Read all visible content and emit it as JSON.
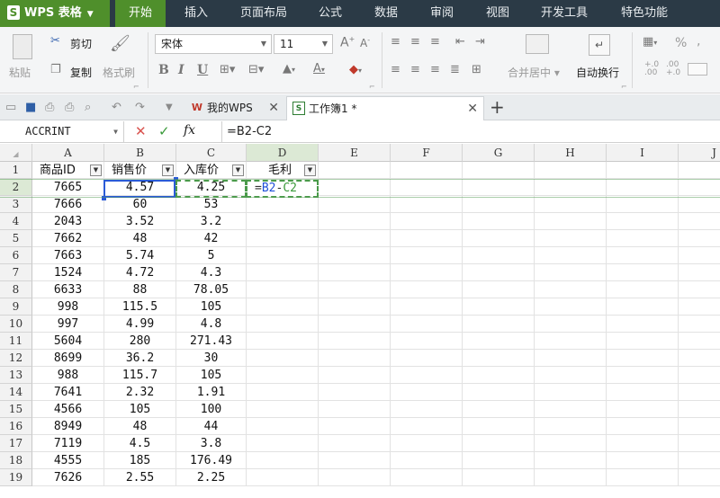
{
  "app": {
    "name": "WPS 表格",
    "logo": "S"
  },
  "menu_tabs": [
    "开始",
    "插入",
    "页面布局",
    "公式",
    "数据",
    "审阅",
    "视图",
    "开发工具",
    "特色功能"
  ],
  "ribbon": {
    "paste": "粘贴",
    "cut": "剪切",
    "copy": "复制",
    "format_painter": "格式刷",
    "font_name": "宋体",
    "font_size": "11",
    "merge_center": "合并居中",
    "wrap_text": "自动换行",
    "percent": "%",
    "dec_inc": "+.0\n.00",
    "dec_dec": ".00\n+.0"
  },
  "doc_tabs": [
    {
      "label": "我的WPS",
      "icon": "W"
    },
    {
      "label": "工作簿1 *",
      "icon": "S"
    }
  ],
  "formula_bar": {
    "name_box": "ACCRINT",
    "formula": "=B2-C2",
    "fx": "fx"
  },
  "grid": {
    "columns": [
      "A",
      "B",
      "C",
      "D",
      "E",
      "F",
      "G",
      "H",
      "I",
      "J"
    ],
    "header_row": [
      "商品ID",
      "销售价",
      "入库价",
      "毛利"
    ],
    "rows": [
      {
        "n": "2",
        "a": "7665",
        "b": "4.57",
        "c": "4.25",
        "d": "=B2-C2"
      },
      {
        "n": "3",
        "a": "7666",
        "b": "60",
        "c": "53",
        "d": ""
      },
      {
        "n": "4",
        "a": "2043",
        "b": "3.52",
        "c": "3.2",
        "d": ""
      },
      {
        "n": "5",
        "a": "7662",
        "b": "48",
        "c": "42",
        "d": ""
      },
      {
        "n": "6",
        "a": "7663",
        "b": "5.74",
        "c": "5",
        "d": ""
      },
      {
        "n": "7",
        "a": "1524",
        "b": "4.72",
        "c": "4.3",
        "d": ""
      },
      {
        "n": "8",
        "a": "6633",
        "b": "88",
        "c": "78.05",
        "d": ""
      },
      {
        "n": "9",
        "a": "998",
        "b": "115.5",
        "c": "105",
        "d": ""
      },
      {
        "n": "10",
        "a": "997",
        "b": "4.99",
        "c": "4.8",
        "d": ""
      },
      {
        "n": "11",
        "a": "5604",
        "b": "280",
        "c": "271.43",
        "d": ""
      },
      {
        "n": "12",
        "a": "8699",
        "b": "36.2",
        "c": "30",
        "d": ""
      },
      {
        "n": "13",
        "a": "988",
        "b": "115.7",
        "c": "105",
        "d": ""
      },
      {
        "n": "14",
        "a": "7641",
        "b": "2.32",
        "c": "1.91",
        "d": ""
      },
      {
        "n": "15",
        "a": "4566",
        "b": "105",
        "c": "100",
        "d": ""
      },
      {
        "n": "16",
        "a": "8949",
        "b": "48",
        "c": "44",
        "d": ""
      },
      {
        "n": "17",
        "a": "7119",
        "b": "4.5",
        "c": "3.8",
        "d": ""
      },
      {
        "n": "18",
        "a": "4555",
        "b": "185",
        "c": "176.49",
        "d": ""
      },
      {
        "n": "19",
        "a": "7626",
        "b": "2.55",
        "c": "2.25",
        "d": ""
      }
    ]
  },
  "colors": {
    "menubar": "#2b3a46",
    "accent": "#4f8f2b",
    "formula_ref_b": "#1f4fd8",
    "formula_ref_c": "#3a9a3a"
  }
}
